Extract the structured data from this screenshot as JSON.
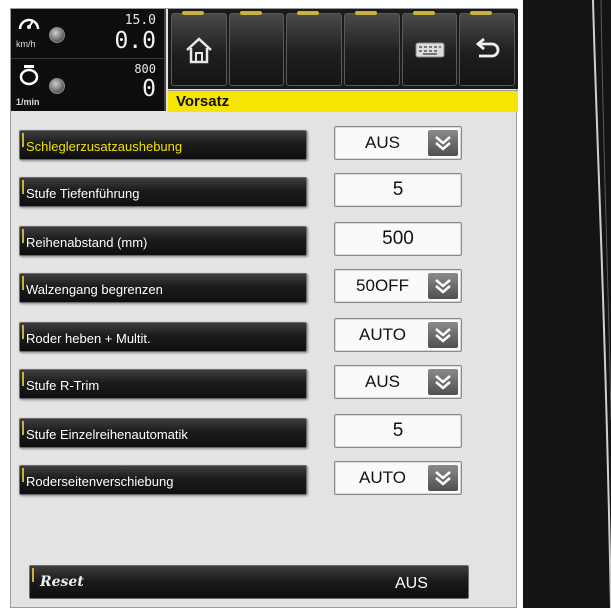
{
  "gauges": {
    "speed": {
      "small": "15.0",
      "big": "0.0",
      "unit": "km/h",
      "icon": "speedometer-icon"
    },
    "rpm": {
      "small": "800",
      "big": "0",
      "unit": "1/min",
      "icon": "engine-icon"
    }
  },
  "toolbar": {
    "buttons": [
      {
        "name": "home-button",
        "icon": "home-icon"
      },
      {
        "name": "blank-button-1",
        "icon": ""
      },
      {
        "name": "blank-button-2",
        "icon": ""
      },
      {
        "name": "blank-button-3",
        "icon": ""
      },
      {
        "name": "keyboard-button",
        "icon": "keyboard-icon"
      },
      {
        "name": "back-button",
        "icon": "back-arrow-icon"
      }
    ]
  },
  "section": {
    "title": "Vorsatz"
  },
  "settings": [
    {
      "label": "Schleglerzusatzaushebung",
      "value": "AUS",
      "type": "select",
      "active": true
    },
    {
      "label": "Stufe Tiefenführung",
      "value": "5",
      "type": "number"
    },
    {
      "label": "Reihenabstand (mm)",
      "value": "500",
      "type": "number"
    },
    {
      "label": "Walzengang begrenzen",
      "value": "50OFF",
      "type": "select"
    },
    {
      "label": "Roder heben + Multit.",
      "value": "AUTO",
      "type": "select"
    },
    {
      "label": "Stufe R-Trim",
      "value": "AUS",
      "type": "select"
    },
    {
      "label": "Stufe Einzelreihenautomatik",
      "value": "5",
      "type": "number"
    },
    {
      "label": "Roderseitenverschiebung",
      "value": "AUTO",
      "type": "select"
    }
  ],
  "reset": {
    "label": "Reset",
    "value": "AUS"
  },
  "colors": {
    "accent": "#f5e500",
    "active_label": "#f0e000",
    "panel": "#0d0d0d"
  }
}
